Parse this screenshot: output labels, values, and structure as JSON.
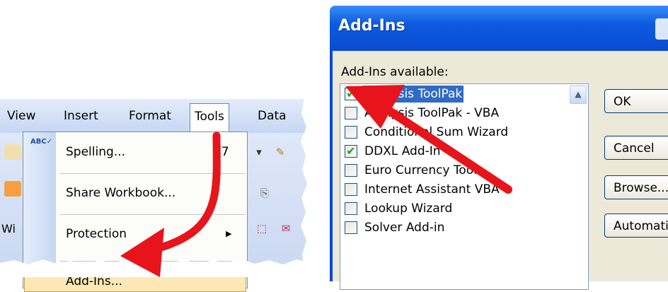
{
  "excel": {
    "menubar": [
      "View",
      "Insert",
      "Format",
      "Tools",
      "Data"
    ],
    "tools_menu": {
      "items": [
        {
          "label": "Spelling...",
          "shortcut": "F7"
        },
        {
          "label": "Share Workbook..."
        },
        {
          "label": "Protection",
          "submenu_indicator": "▶"
        },
        {
          "label": "Add-Ins..."
        }
      ]
    },
    "toolbar_fragment_text": "Wi"
  },
  "dialog": {
    "title": "Add-Ins",
    "available_label": "Add-Ins available:",
    "items": [
      {
        "label": "Analysis ToolPak",
        "checked": true,
        "selected": true
      },
      {
        "label": "Analysis ToolPak - VBA",
        "checked": false
      },
      {
        "label": "Conditional Sum Wizard",
        "checked": false
      },
      {
        "label": "DDXL Add-In",
        "checked": true
      },
      {
        "label": "Euro Currency Tools",
        "checked": false
      },
      {
        "label": "Internet Assistant VBA",
        "checked": false
      },
      {
        "label": "Lookup Wizard",
        "checked": false
      },
      {
        "label": "Solver Add-in",
        "checked": false
      }
    ],
    "buttons": [
      "OK",
      "Cancel",
      "Browse...",
      "Automation..."
    ],
    "checkmark_glyph": "✔"
  },
  "colors": {
    "arrow": "#e8141b",
    "title_bar": "#0a4bd2",
    "selection": "#316ac5",
    "menu_highlight": "#fde8b4"
  }
}
